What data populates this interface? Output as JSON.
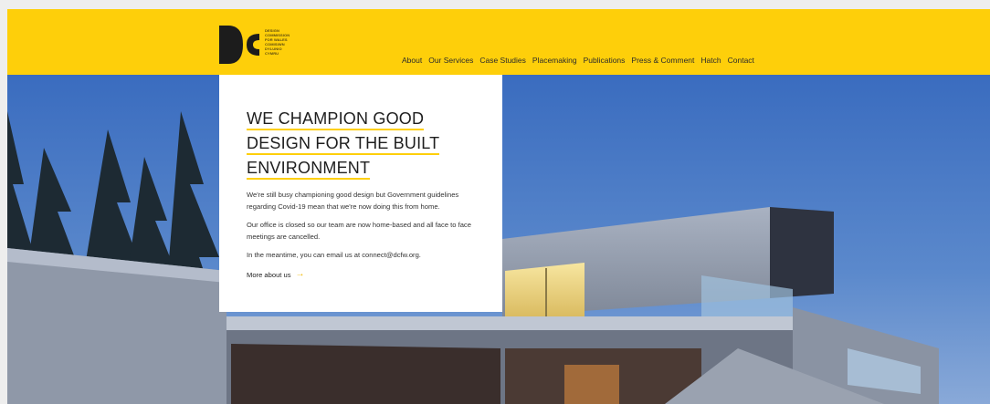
{
  "logo": {
    "mark_text": "DC",
    "lines": [
      "DESIGN",
      "COMMISSION",
      "FOR WALES",
      "COMISIWN",
      "DYLUNIO",
      "CYMRU"
    ]
  },
  "nav": {
    "items": [
      "About",
      "Our Services",
      "Case Studies",
      "Placemaking",
      "Publications",
      "Press & Comment",
      "Hatch",
      "Contact"
    ]
  },
  "hero": {
    "heading_lines": [
      "WE CHAMPION GOOD",
      "DESIGN FOR THE BUILT",
      "ENVIRONMENT"
    ],
    "paragraphs": [
      "We're still busy championing good design but Government guidelines regarding Covid-19 mean that we're now doing this from home.",
      "Our office is closed so our team are now home-based and all face to face meetings are cancelled.",
      "In the meantime, you can email us at connect@dcfw.org."
    ],
    "more_link": "More about us",
    "arrow": "→"
  },
  "colors": {
    "brand_yellow": "#fecf0a",
    "sky_blue": "#3f6fb8"
  }
}
